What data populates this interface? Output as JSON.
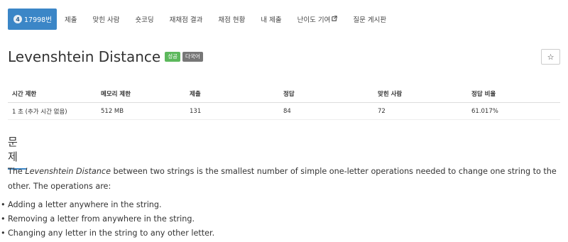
{
  "nav": {
    "problem_id": "17998번",
    "tier_icon": "tier-badge-icon",
    "tier_glyph": "4",
    "tabs": [
      "제출",
      "맞힌 사람",
      "숏코딩",
      "재채점 결과",
      "채점 현황",
      "내 제출",
      "난이도 기여",
      "질문 게시판"
    ]
  },
  "problem": {
    "title": "Levenshtein Distance",
    "badge_success": "성공",
    "badge_lang": "다국어",
    "star_glyph": "☆"
  },
  "info_table": {
    "headers": [
      "시간 제한",
      "메모리 제한",
      "제출",
      "정답",
      "맞힌 사람",
      "정답 비율"
    ],
    "row": [
      "1 초 (추가 시간 없음)",
      "512 MB",
      "131",
      "84",
      "72",
      "61.017%"
    ]
  },
  "section": {
    "heading": "문제",
    "desc_term": "Levenshtein Distance",
    "desc_prefix": "The ",
    "desc_suffix": " between two strings is the smallest number of simple one-letter operations needed to change one string to the other. The operations are:",
    "operations": [
      "Adding a letter anywhere in the string.",
      "Removing a letter from anywhere in the string.",
      "Changing any letter in the string to any other letter."
    ]
  },
  "colors": {
    "accent": "#3b86c7",
    "success": "#5cb85c",
    "lang_badge": "#777777"
  }
}
